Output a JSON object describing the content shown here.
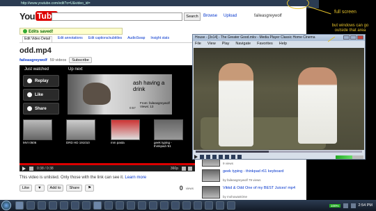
{
  "browser": {
    "url": "http://www.youtube.com/edit?o=U&video_id="
  },
  "youtube": {
    "logo_you": "You",
    "logo_tube": "Tube",
    "search_button": "Search",
    "header_links": [
      "Browse",
      "Upload"
    ],
    "username": "faileasgreywolf",
    "saved_message": "Edits saved!",
    "edit_tabs": [
      "Edit Video Detail",
      "Edit annotations",
      "Edit captions/subtitles",
      "AudioSwap",
      "Insight stats"
    ],
    "video_title": "odd.mp4",
    "owner": "faileasgreywolf",
    "videos_count": "59 videos",
    "subscribe_label": "Subscribe",
    "player": {
      "just_watched": "Just watched",
      "up_next": "Up next",
      "replay_label": "Replay",
      "like_label": "Like",
      "share_label": "Share",
      "up_next_title": "ash having a drink",
      "up_next_from": "From: faileasgreywolf",
      "up_next_views": "Views: 13",
      "up_next_time": "0:57",
      "minis": [
        {
          "caption": "MVI 0506",
          "time": "0:17"
        },
        {
          "caption": "DRD HD 191010",
          "time": "0:14"
        },
        {
          "caption": "mm pasta",
          "time": "0:05"
        },
        {
          "caption": "geek typing - thinkpad r61",
          "time": "1:17"
        }
      ],
      "time_display": "0:38 / 0:38",
      "quality": "360p",
      "progress_fraction": 1.0
    },
    "unlisted_note": "This video is unlisted. Only those with the link can see it.",
    "learn_more": "Learn more",
    "actions": [
      "Like",
      "Add to",
      "Share"
    ],
    "views": "0",
    "views_label": "views",
    "related": [
      {
        "title": "",
        "meta": "9 views",
        "time": ""
      },
      {
        "title": "geek typing - thinkpad r61 keyboard",
        "meta": "by faileasgreywolf 79 views",
        "time": "1:17"
      },
      {
        "title": "Vikkd & Odd One of my BEST Juices! mp4",
        "meta": "by mohowastOne",
        "time": ""
      }
    ]
  },
  "vlc": {
    "title": "House - [3x14] - The Greater Good.mkv - Media Player Classic Home Cinema",
    "menu": [
      "File",
      "View",
      "Play",
      "Navigate",
      "Favorites",
      "Help"
    ],
    "seek_fraction": 0.44,
    "volume_fraction": 0.6
  },
  "annotations": {
    "full_screen": "full screen",
    "outside_area": "but windows can go outside that area"
  },
  "taskbar": {
    "battery": "100%",
    "time": "2:54 PM"
  },
  "colors": {
    "annotation": "#e5c22b",
    "youtube_red": "#dd0000",
    "link_blue": "#0033cc"
  }
}
